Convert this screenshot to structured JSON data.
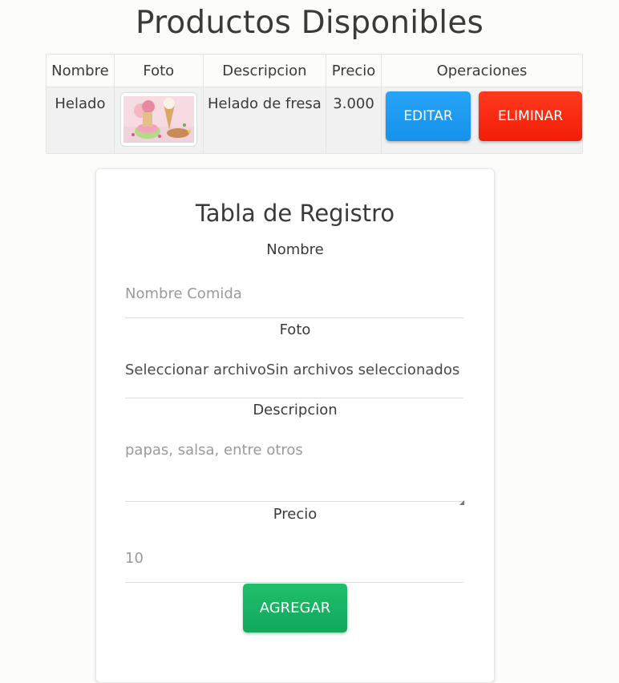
{
  "page": {
    "title": "Productos Disponibles"
  },
  "table": {
    "headers": [
      "Nombre",
      "Foto",
      "Descripcion",
      "Precio",
      "Operaciones"
    ],
    "rows": [
      {
        "nombre": "Helado",
        "foto": "ice-cream-photo",
        "descripcion": "Helado de fresa",
        "precio": "3.000",
        "edit_label": "EDITAR",
        "delete_label": "ELIMINAR"
      }
    ]
  },
  "form": {
    "title": "Tabla de Registro",
    "nombre_label": "Nombre",
    "nombre_placeholder": "Nombre Comida",
    "foto_label": "Foto",
    "file_button_text": "Seleccionar archivo",
    "file_status_text": "Sin archivos seleccionados",
    "descripcion_label": "Descripcion",
    "descripcion_placeholder": "papas, salsa, entre otros",
    "precio_label": "Precio",
    "precio_placeholder": "10",
    "submit_label": "AGREGAR"
  },
  "colors": {
    "edit_button": "#1a98f0",
    "delete_button": "#f72810",
    "add_button": "#17b062",
    "text": "#3a3a3a"
  }
}
